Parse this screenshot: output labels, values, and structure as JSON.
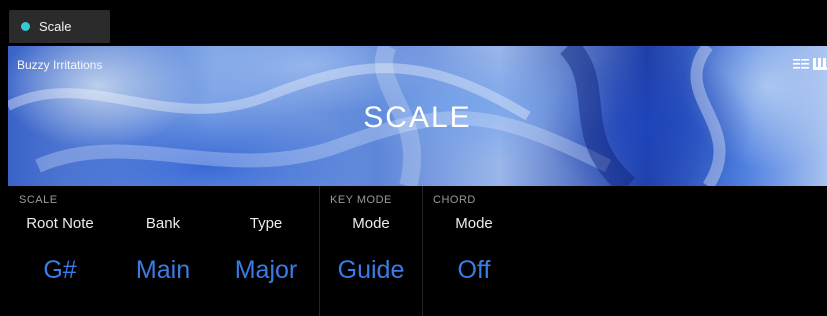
{
  "colors": {
    "accent": "#3a7ce6",
    "tab_dot": "#37c8d6",
    "section_label": "#9a9a9a"
  },
  "tab": {
    "label": "Scale"
  },
  "hero": {
    "preset_name": "Buzzy Irritations",
    "title": "SCALE",
    "icons": [
      "list-icon",
      "keyboard-icon"
    ]
  },
  "sections": {
    "scale": "SCALE",
    "key_mode": "KEY MODE",
    "chord": "CHORD"
  },
  "params": {
    "root_note": {
      "name": "Root Note",
      "value": "G#"
    },
    "bank": {
      "name": "Bank",
      "value": "Main"
    },
    "type": {
      "name": "Type",
      "value": "Major"
    },
    "key_mode": {
      "name": "Mode",
      "value": "Guide"
    },
    "chord_mode": {
      "name": "Mode",
      "value": "Off"
    }
  }
}
